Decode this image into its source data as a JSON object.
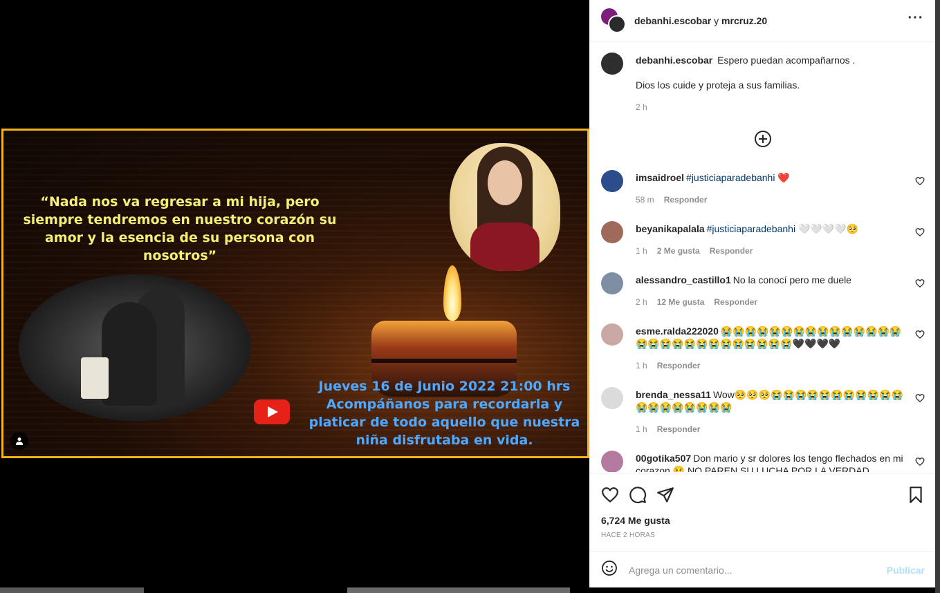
{
  "post": {
    "quote": "“Nada nos va regresar a mi hija, pero siempre tendremos en nuestro corazón su amor y la esencia de su persona con nosotros”",
    "event_line1": "Jueves 16 de Junio 2022  21:00 hrs",
    "event_line2": "Acompáñanos para recordarla y platicar de todo aquello que nuestra niña disfrutaba en vida."
  },
  "header": {
    "user1": "debanhi.escobar",
    "connector": "y",
    "user2": "mrcruz.20",
    "more_icon": "more-horizontal-icon"
  },
  "caption": {
    "user": "debanhi.escobar",
    "line1": "Espero puedan acompañarnos .",
    "line2": "Dios los cuide y proteja a sus familias.",
    "time": "2 h"
  },
  "comments": [
    {
      "user": "imsaidroel",
      "hashtag": "#justiciaparadebanhi",
      "text": " ❤️",
      "time": "58 m",
      "likes": "",
      "reply": "Responder",
      "avatar_color": "#2b4d8c"
    },
    {
      "user": "beyanikapalala",
      "hashtag": "#justiciaparadebanhi",
      "text": " 🤍🤍🤍🤍🥺",
      "time": "1 h",
      "likes": "2 Me gusta",
      "reply": "Responder",
      "avatar_color": "#a06a5a"
    },
    {
      "user": "alessandro_castillo1",
      "hashtag": "",
      "text": "No la conocí pero me duele",
      "time": "2 h",
      "likes": "12 Me gusta",
      "reply": "Responder",
      "avatar_color": "#7f8fa3"
    },
    {
      "user": "esme.ralda222020",
      "hashtag": "",
      "text": "😭😭😭😭😭😭😭😭😭😭😭😭😭😭😭😭😭😭😭😭😭😭😭😭😭😭😭😭🖤🖤🖤🖤",
      "time": "1 h",
      "likes": "",
      "reply": "Responder",
      "avatar_color": "#c9a7a2"
    },
    {
      "user": "brenda_nessa11",
      "hashtag": "",
      "text": "Wow🥺🥺🥺😭😭😭😭😭😭😭😭😭😭😭😭😭😭😭😭😭😭😭",
      "time": "1 h",
      "likes": "",
      "reply": "Responder",
      "avatar_color": "#dbdbdb"
    },
    {
      "user": "00gotika507",
      "hashtag": "",
      "text": "Don mario y sr dolores los tengo flechados en mi corazon 😢 NO PAREN SU LUCHA POR LA VERDAD",
      "time": "",
      "likes": "",
      "reply": "",
      "avatar_color": "#b57aa0"
    }
  ],
  "actions": {
    "likes": "6,724 Me gusta",
    "time": "HACE 2 HORAS"
  },
  "comment_box": {
    "placeholder": "Agrega un comentario...",
    "publish": "Publicar"
  },
  "colors": {
    "frame_border": "#f2b418",
    "quote_text": "#f6f074",
    "event_text": "#4fa8ff",
    "hashtag": "#00376b",
    "publish_disabled": "#b2dffc"
  }
}
